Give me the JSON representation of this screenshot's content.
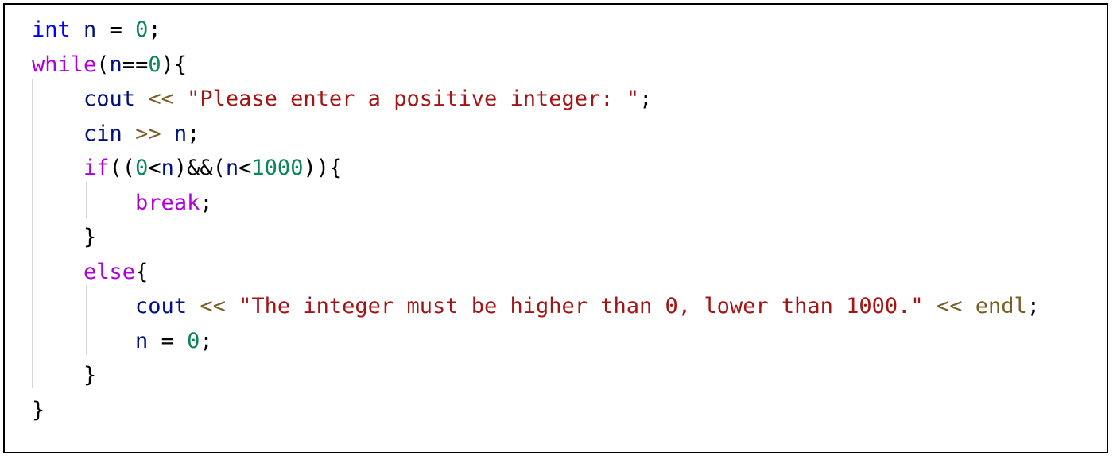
{
  "code_view": {
    "lines": [
      {
        "indent": 0,
        "tokens": [
          {
            "type": "type",
            "text": "int"
          },
          {
            "type": "ident",
            "text": " n "
          },
          {
            "type": "punct",
            "text": "= "
          },
          {
            "type": "number",
            "text": "0"
          },
          {
            "type": "punct",
            "text": ";"
          }
        ]
      },
      {
        "indent": 0,
        "tokens": [
          {
            "type": "keyword",
            "text": "while"
          },
          {
            "type": "punct",
            "text": "("
          },
          {
            "type": "ident",
            "text": "n"
          },
          {
            "type": "punct",
            "text": "=="
          },
          {
            "type": "number",
            "text": "0"
          },
          {
            "type": "punct",
            "text": "){"
          }
        ]
      },
      {
        "indent": 1,
        "tokens": [
          {
            "type": "ident",
            "text": "cout"
          },
          {
            "type": "punct",
            "text": " "
          },
          {
            "type": "operator",
            "text": "<<"
          },
          {
            "type": "punct",
            "text": " "
          },
          {
            "type": "string",
            "text": "\"Please enter a positive integer: \""
          },
          {
            "type": "punct",
            "text": ";"
          }
        ]
      },
      {
        "indent": 1,
        "tokens": [
          {
            "type": "ident",
            "text": "cin"
          },
          {
            "type": "punct",
            "text": " "
          },
          {
            "type": "operator",
            "text": ">>"
          },
          {
            "type": "ident",
            "text": " n"
          },
          {
            "type": "punct",
            "text": ";"
          }
        ]
      },
      {
        "indent": 1,
        "tokens": [
          {
            "type": "keyword",
            "text": "if"
          },
          {
            "type": "punct",
            "text": "(("
          },
          {
            "type": "number",
            "text": "0"
          },
          {
            "type": "punct",
            "text": "<"
          },
          {
            "type": "ident",
            "text": "n"
          },
          {
            "type": "punct",
            "text": ")&&("
          },
          {
            "type": "ident",
            "text": "n"
          },
          {
            "type": "punct",
            "text": "<"
          },
          {
            "type": "number",
            "text": "1000"
          },
          {
            "type": "punct",
            "text": ")){"
          }
        ]
      },
      {
        "indent": 2,
        "tokens": [
          {
            "type": "keyword",
            "text": "break"
          },
          {
            "type": "punct",
            "text": ";"
          }
        ]
      },
      {
        "indent": 1,
        "tokens": [
          {
            "type": "punct",
            "text": "}"
          }
        ]
      },
      {
        "indent": 1,
        "tokens": [
          {
            "type": "keyword",
            "text": "else"
          },
          {
            "type": "punct",
            "text": "{"
          }
        ]
      },
      {
        "indent": 2,
        "tokens": [
          {
            "type": "ident",
            "text": "cout"
          },
          {
            "type": "punct",
            "text": " "
          },
          {
            "type": "operator",
            "text": "<<"
          },
          {
            "type": "punct",
            "text": " "
          },
          {
            "type": "string",
            "text": "\"The integer must be higher than 0, lower than 1000.\""
          },
          {
            "type": "punct",
            "text": " "
          },
          {
            "type": "operator",
            "text": "<<"
          },
          {
            "type": "punct",
            "text": " "
          },
          {
            "type": "operator",
            "text": "endl"
          },
          {
            "type": "punct",
            "text": ";"
          }
        ]
      },
      {
        "indent": 2,
        "tokens": [
          {
            "type": "ident",
            "text": "n "
          },
          {
            "type": "punct",
            "text": "= "
          },
          {
            "type": "number",
            "text": "0"
          },
          {
            "type": "punct",
            "text": ";"
          }
        ]
      },
      {
        "indent": 1,
        "tokens": [
          {
            "type": "punct",
            "text": "}"
          }
        ]
      },
      {
        "indent": 0,
        "tokens": [
          {
            "type": "punct",
            "text": "}"
          }
        ]
      }
    ],
    "colors": {
      "keyword": "#af00db",
      "type": "#0000ff",
      "number": "#098658",
      "string": "#a31515",
      "operator": "#795e26",
      "identifier": "#001080",
      "punctuation": "#000000",
      "indent_guide": "#d4d4d4"
    }
  }
}
